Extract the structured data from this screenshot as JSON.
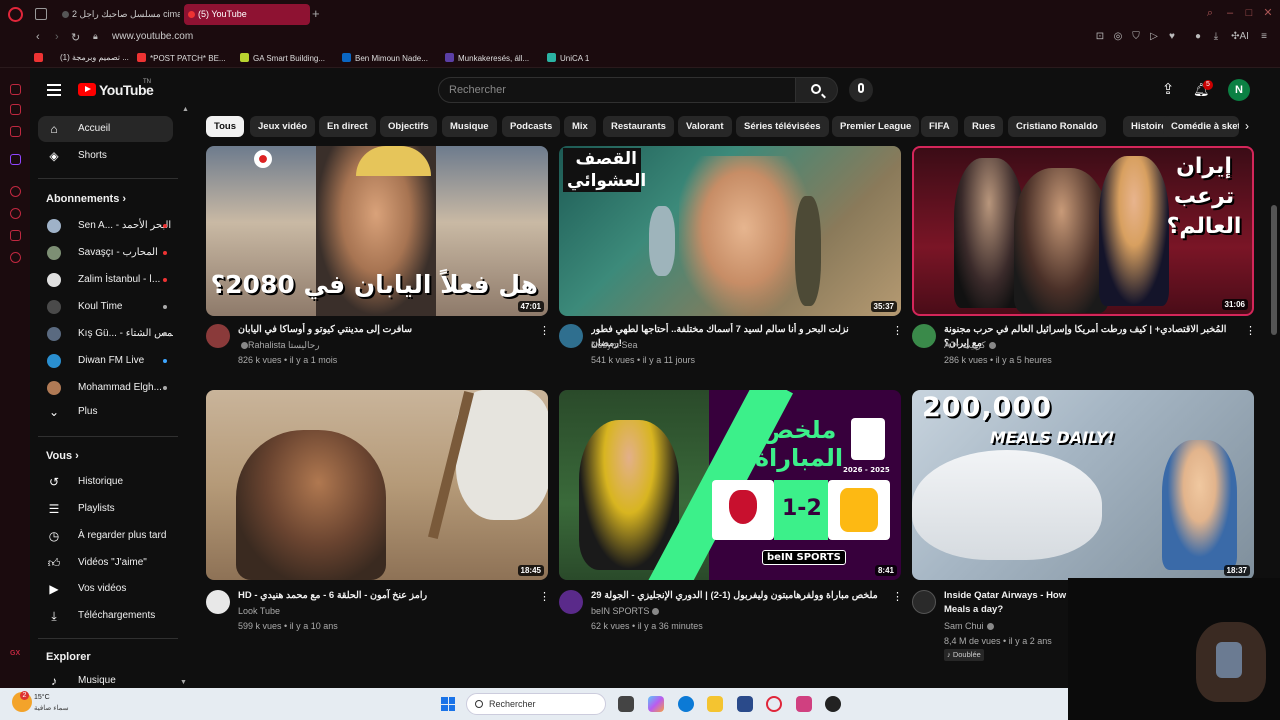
{
  "browser": {
    "tabs": [
      {
        "label": "مسلسل صاحبك راجل 2 cima",
        "active": false
      },
      {
        "label": "(5) YouTube",
        "active": true
      }
    ],
    "url": "www.youtube.com",
    "bookmarks": [
      {
        "label": "تصميم وبرمجة (1) ...",
        "color": "#e33"
      },
      {
        "label": "*POST PATCH* BE...",
        "color": "#e33"
      },
      {
        "label": "GA Smart Building...",
        "color": "#b8d430"
      },
      {
        "label": "Ben Mimoun Nade...",
        "color": "#0a66c2"
      },
      {
        "label": "Munkakeresés, áll...",
        "color": "#5b3fa5"
      },
      {
        "label": "UniCA 1",
        "color": "#2bb3a3"
      }
    ],
    "ai_label": "AI"
  },
  "youtube": {
    "logo_text": "YouTube",
    "logo_sup": "TN",
    "search_placeholder": "Rechercher",
    "notification_count": "5",
    "avatar_letter": "N",
    "colors": {
      "brand": "#ff0000",
      "background": "#0f0f0f",
      "avatar": "#0b8043"
    }
  },
  "sidebar": {
    "main": [
      {
        "label": "Accueil",
        "icon": "home-icon",
        "active": true
      },
      {
        "label": "Shorts",
        "icon": "shorts-icon",
        "active": false
      }
    ],
    "subscriptions_heading": "Abonnements",
    "subscriptions": [
      {
        "label": "Sen A... - البحر الأحمد",
        "color": "#9fb2c8",
        "live": true
      },
      {
        "label": "Savaşçı - المحارب",
        "color": "#7d8f74",
        "live": true
      },
      {
        "label": "Zalim İstanbul - ا...",
        "color": "#e0e0e0",
        "live": true
      },
      {
        "label": "Koul Time",
        "color": "#4a4a4a",
        "live": true
      },
      {
        "label": "Kış Gü... - شمس الشتاء",
        "color": "#5a6a80",
        "live": true
      },
      {
        "label": "Diwan FM Live",
        "color": "#2a8fd0",
        "live": true
      },
      {
        "label": "Mohammad Elgh...",
        "color": "#b07a55",
        "live": true
      }
    ],
    "more_label": "Plus",
    "you_heading": "Vous",
    "you_items": [
      {
        "label": "Historique",
        "icon": "history-icon"
      },
      {
        "label": "Playlists",
        "icon": "playlists-icon"
      },
      {
        "label": "À regarder plus tard",
        "icon": "watch-later-icon"
      },
      {
        "label": "Vidéos \"J'aime\"",
        "icon": "like-icon"
      },
      {
        "label": "Vos vidéos",
        "icon": "your-videos-icon"
      },
      {
        "label": "Téléchargements",
        "icon": "download-icon"
      }
    ],
    "explore_heading": "Explorer",
    "explore_items": [
      {
        "label": "Musique",
        "icon": "music-icon"
      }
    ]
  },
  "chips": [
    "Tous",
    "Jeux vidéo",
    "En direct",
    "Objectifs",
    "Musique",
    "Podcasts",
    "Mix",
    "Restaurants",
    "Valorant",
    "Séries télévisées",
    "Premier League",
    "FIFA",
    "Rues",
    "Cristiano Ronaldo",
    "Histoire",
    "Comédie à sketc"
  ],
  "videos": [
    {
      "title": "سافرت إلى مدينتي كيوتو و أوساكا في اليابان",
      "channel": "Rahalista رحاليستا",
      "verified": true,
      "views": "826 k vues",
      "age": "il y a 1 mois",
      "duration": "47:01",
      "thumb_text": "هل فعلاً اليابان في 2080؟",
      "avatar_color": "#8a3a3a"
    },
    {
      "title": "نزلت البحر و أنا سالم لسيد 7 أسماك مختلفة.. أحتاجها لطهي فطور رمضان!",
      "channel": "Nesym Sea",
      "verified": false,
      "views": "541 k vues",
      "age": "il y a 11 jours",
      "duration": "35:37",
      "thumb_text": "القصف العشوائي",
      "avatar_color": "#2f6f8f"
    },
    {
      "title": "المُخبر الاقتصادي+ | كيف ورطت أمريكا وإسرائيل العالم في حرب مجنونة مع إيران؟",
      "channel": "AJ+ كربيت",
      "verified": true,
      "views": "286 k vues",
      "age": "il y a 5 heures",
      "duration": "31:06",
      "thumb_text": "إيران ترعب العالم؟",
      "avatar_color": "#3a8a4a"
    },
    {
      "title": "HD - رامز عنخ آمون - الحلقة 6 - مع محمد هنيدي",
      "channel": "Look Tube",
      "verified": false,
      "views": "599 k vues",
      "age": "il y a 10 ans",
      "duration": "18:45",
      "thumb_text": "",
      "avatar_color": "#e8e8e8"
    },
    {
      "title": "ملخص مباراة وولفرهامبتون وليفربول (1-2) | الدوري الإنجليزي - الجولة 29",
      "channel": "beIN SPORTS",
      "verified": true,
      "views": "62 k vues",
      "age": "il y a 36 minutes",
      "duration": "8:41",
      "thumb_text": "ملخص المباراة",
      "score": "1-2",
      "season": "2026 - 2025",
      "brand": "beIN SPORTS",
      "avatar_color": "#5a2a8a"
    },
    {
      "title": "Inside Qatar Airways - How Meals a day?",
      "channel": "Sam Chui",
      "verified": true,
      "views": "8,4 M de vues",
      "age": "il y a 2 ans",
      "duration": "18:37",
      "thumb_text_1": "200,000",
      "thumb_text_2": "MEALS DAILY!",
      "badge": "Doublée",
      "avatar_color": "#2a2a2a"
    }
  ],
  "taskbar": {
    "temperature": "15°C",
    "weather_desc": "سماء صافية",
    "weather_badge": "2",
    "search_placeholder": "Rechercher"
  }
}
